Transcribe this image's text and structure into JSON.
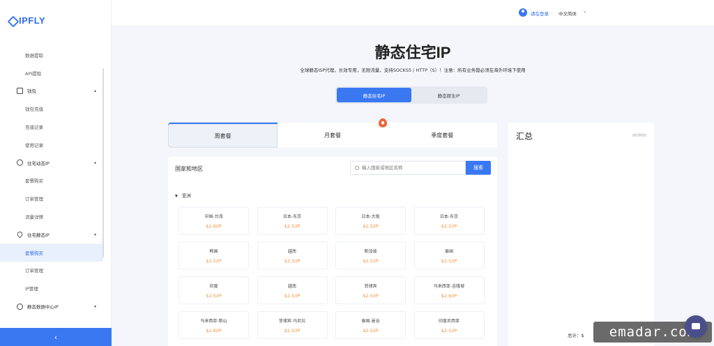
{
  "brand": {
    "name": "IPFLY",
    "accent": "#3a78f2"
  },
  "sidebar": {
    "items": [
      {
        "label": "数据提取",
        "type": "sub"
      },
      {
        "label": "API提取",
        "type": "sub"
      },
      {
        "label": "钱包",
        "type": "group",
        "icon": "wallet-icon"
      },
      {
        "label": "钱包充值",
        "type": "sub"
      },
      {
        "label": "充值记录",
        "type": "sub"
      },
      {
        "label": "使用记录",
        "type": "sub"
      },
      {
        "label": "住宅动态IP",
        "type": "group",
        "icon": "globe-icon"
      },
      {
        "label": "套餐购买",
        "type": "sub"
      },
      {
        "label": "订单管理",
        "type": "sub"
      },
      {
        "label": "流量详情",
        "type": "sub"
      },
      {
        "label": "住宅静态IP",
        "type": "group",
        "icon": "location-pin-icon"
      },
      {
        "label": "套餐购买",
        "type": "sub",
        "active": true
      },
      {
        "label": "订单管理",
        "type": "sub"
      },
      {
        "label": "IP管理",
        "type": "sub"
      },
      {
        "label": "静态数据中心IP",
        "type": "group",
        "icon": "datacenter-globe-icon"
      }
    ],
    "collapse_glyph": "‹"
  },
  "header": {
    "login_label": "请在登录",
    "language": "中文简体"
  },
  "hero": {
    "title": "静态住宅IP",
    "subtitle": "全球静态ISP代理，长效专用，无限流量，支持SOCKS5 / HTTP（S）！注意：所有业务都必须在海外环境下使用",
    "segments": [
      "静态住宅IP",
      "静态原生IP"
    ]
  },
  "plans": {
    "tabs": [
      "周套餐",
      "月套餐",
      "季度套餐"
    ]
  },
  "regions": {
    "title": "国家和地区",
    "search_placeholder": "输入国家或地区名称",
    "search_label": "搜索",
    "continent": "亚洲",
    "cards": [
      {
        "name": "中国-台湾",
        "price": "$2.6/IP"
      },
      {
        "name": "日本-东京",
        "price": "$2.5/IP"
      },
      {
        "name": "日本-大阪",
        "price": "$2.5/IP"
      },
      {
        "name": "日本-东京",
        "price": "$2.5/IP"
      },
      {
        "name": "韩国",
        "price": "$2.5/IP"
      },
      {
        "name": "越南",
        "price": "$2.5/IP"
      },
      {
        "name": "新加坡",
        "price": "$2.5/IP"
      },
      {
        "name": "泰国",
        "price": "$2.5/IP"
      },
      {
        "name": "印度",
        "price": "$2.5/IP"
      },
      {
        "name": "越南",
        "price": "$2.5/IP"
      },
      {
        "name": "菲律宾",
        "price": "$2.5/IP"
      },
      {
        "name": "马来西亚-吉隆坡",
        "price": "$2.6/IP"
      },
      {
        "name": "马来西亚-新山",
        "price": "$2.6/IP"
      },
      {
        "name": "菲律宾-马尼拉",
        "price": "$2.5/IP"
      },
      {
        "name": "泰国-曼谷",
        "price": "$2.5/IP"
      },
      {
        "name": "印度尼西亚",
        "price": "$2.5/IP"
      }
    ]
  },
  "summary": {
    "title": "汇总",
    "count": "(0/300)",
    "total_label": "总计：$"
  },
  "watermark": "emadar.com"
}
